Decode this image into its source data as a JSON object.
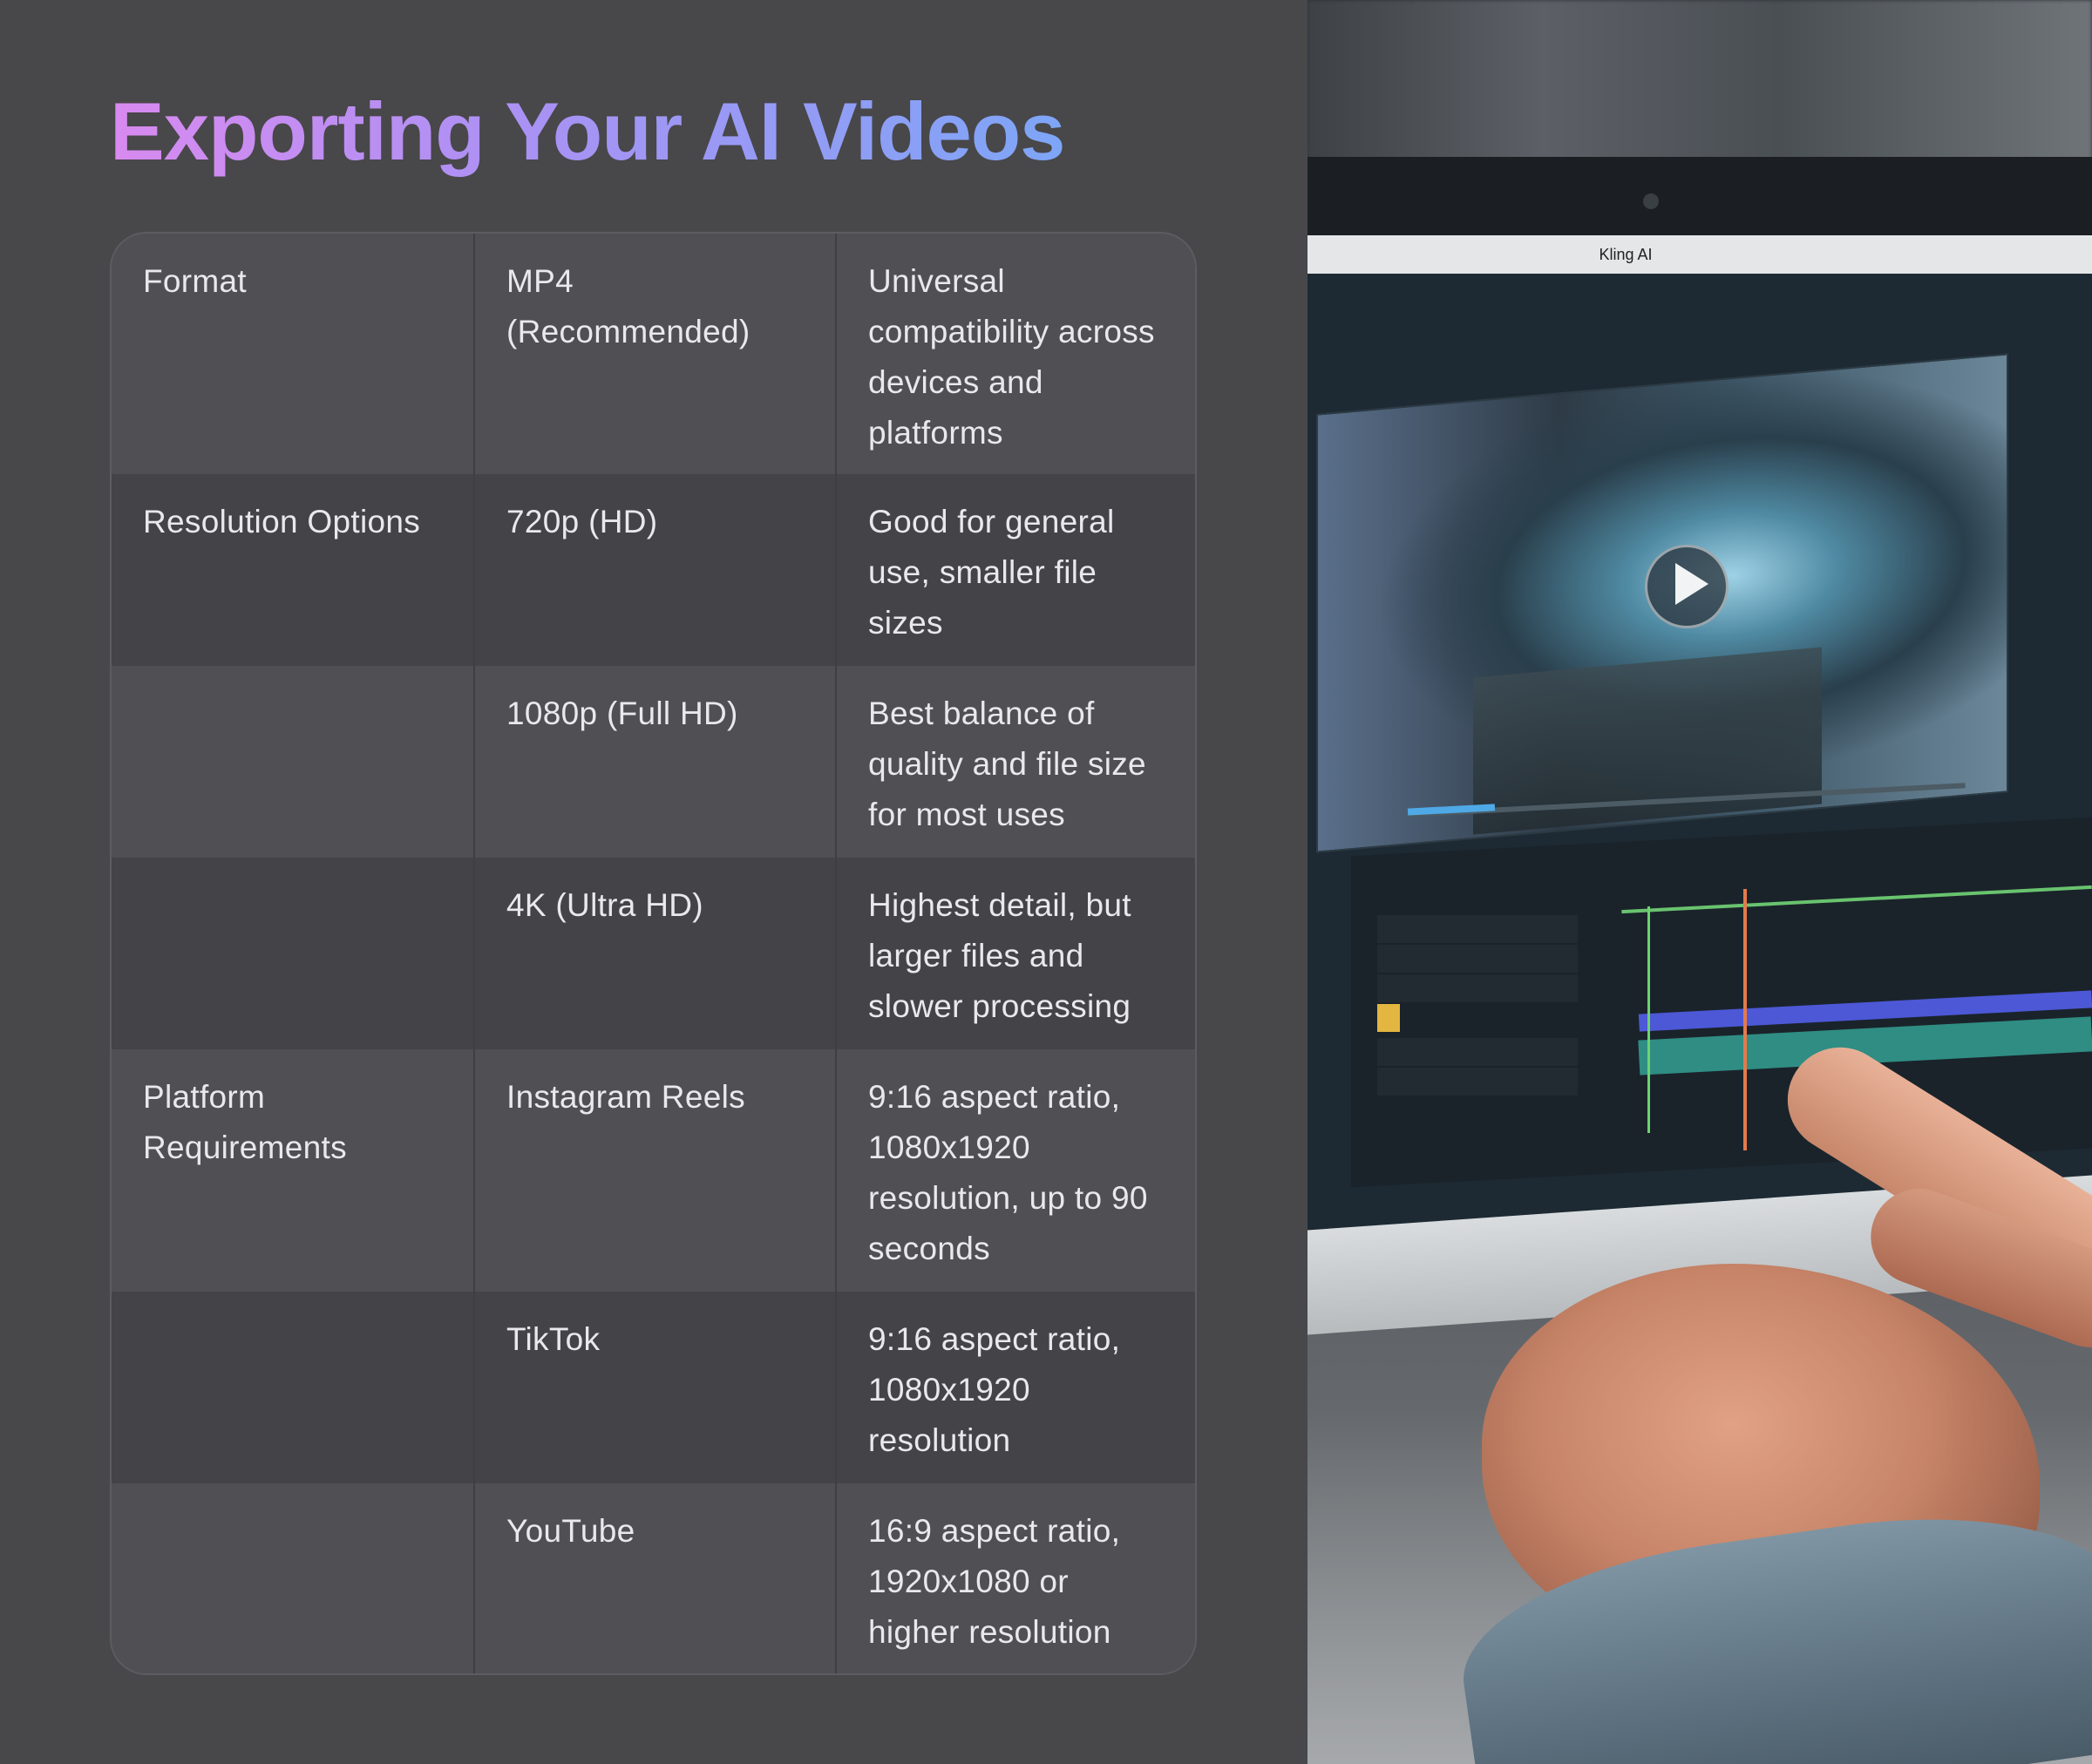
{
  "title": "Exporting Your AI Videos",
  "table": {
    "rows": [
      {
        "category": "Format",
        "option": "MP4\n(Recommended)",
        "description": "Universal\ncompatibility across\ndevices and\nplatforms"
      },
      {
        "category": "Resolution Options",
        "option": "720p (HD)",
        "description": "Good for general\nuse, smaller file\nsizes"
      },
      {
        "category": "",
        "option": "1080p (Full HD)",
        "description": "Best balance of\nquality and file size\nfor most uses"
      },
      {
        "category": "",
        "option": "4K (Ultra HD)",
        "description": "Highest detail, but\nlarger files and\nslower processing"
      },
      {
        "category": "Platform\nRequirements",
        "option": "Instagram Reels",
        "description": "9:16 aspect ratio,\n1080x1920\nresolution, up to 90\nseconds"
      },
      {
        "category": "",
        "option": "TikTok",
        "description": "9:16 aspect ratio,\n1080x1920\nresolution"
      },
      {
        "category": "",
        "option": "YouTube",
        "description": "16:9 aspect ratio,\n1920x1080 or\nhigher resolution"
      }
    ]
  },
  "photo": {
    "app_name": "Kling AI"
  },
  "colors": {
    "background": "#48474a",
    "title_gradient_start": "#d88af0",
    "title_gradient_end": "#7ea6f6",
    "row_odd": "#504f53",
    "row_even": "#444347",
    "text": "#e9e8ec"
  }
}
